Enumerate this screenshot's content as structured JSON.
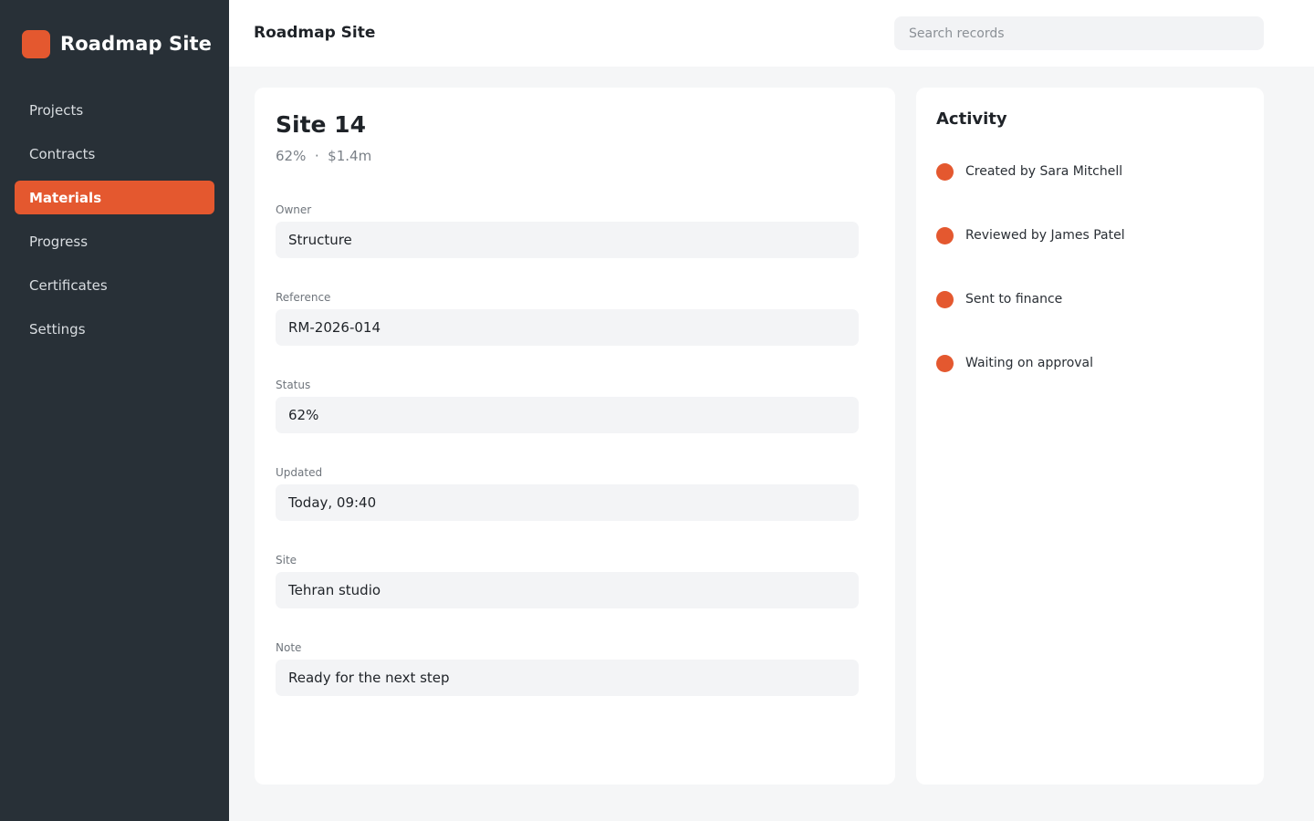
{
  "app": {
    "brand": "Roadmap Site"
  },
  "colors": {
    "accent": "#e4582f",
    "sidebar": "#283037"
  },
  "sidebar": {
    "items": [
      {
        "label": "Projects",
        "active": false
      },
      {
        "label": "Contracts",
        "active": false
      },
      {
        "label": "Materials",
        "active": true
      },
      {
        "label": "Progress",
        "active": false
      },
      {
        "label": "Certificates",
        "active": false
      },
      {
        "label": "Settings",
        "active": false
      }
    ]
  },
  "header": {
    "title": "Roadmap Site",
    "search_placeholder": "Search records",
    "search_value": ""
  },
  "record": {
    "title": "Site 14",
    "meta": "62%  ·  $1.4m",
    "fields": [
      {
        "label": "Owner",
        "value": "Structure"
      },
      {
        "label": "Reference",
        "value": "RM-2026-014"
      },
      {
        "label": "Status",
        "value": "62%"
      },
      {
        "label": "Updated",
        "value": "Today, 09:40"
      },
      {
        "label": "Site",
        "value": "Tehran studio"
      },
      {
        "label": "Note",
        "value": "Ready for the next step"
      }
    ]
  },
  "activity": {
    "title": "Activity",
    "items": [
      {
        "text": "Created by Sara Mitchell"
      },
      {
        "text": "Reviewed by James Patel"
      },
      {
        "text": "Sent to finance"
      },
      {
        "text": "Waiting on approval"
      }
    ]
  }
}
